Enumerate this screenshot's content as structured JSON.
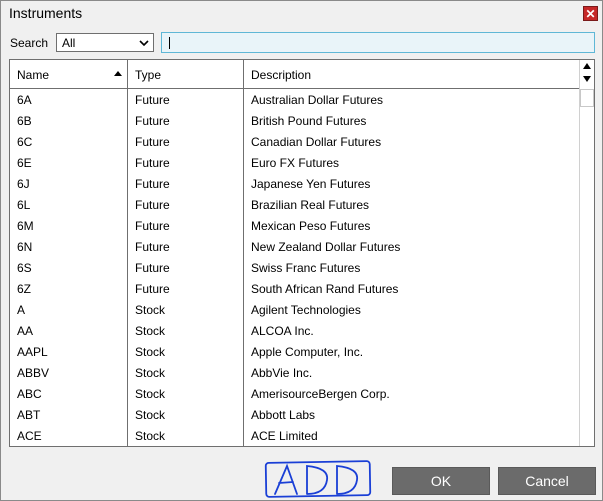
{
  "window": {
    "title": "Instruments"
  },
  "search": {
    "label": "Search",
    "selected": "All",
    "query": ""
  },
  "grid": {
    "columns": [
      "Name",
      "Type",
      "Description"
    ],
    "rows": [
      {
        "name": "6A",
        "type": "Future",
        "description": "Australian Dollar Futures"
      },
      {
        "name": "6B",
        "type": "Future",
        "description": "British Pound Futures"
      },
      {
        "name": "6C",
        "type": "Future",
        "description": "Canadian Dollar Futures"
      },
      {
        "name": "6E",
        "type": "Future",
        "description": "Euro FX Futures"
      },
      {
        "name": "6J",
        "type": "Future",
        "description": "Japanese Yen Futures"
      },
      {
        "name": "6L",
        "type": "Future",
        "description": "Brazilian Real Futures"
      },
      {
        "name": "6M",
        "type": "Future",
        "description": "Mexican Peso Futures"
      },
      {
        "name": "6N",
        "type": "Future",
        "description": "New Zealand Dollar Futures"
      },
      {
        "name": "6S",
        "type": "Future",
        "description": "Swiss Franc Futures"
      },
      {
        "name": "6Z",
        "type": "Future",
        "description": "South African Rand Futures"
      },
      {
        "name": "A",
        "type": "Stock",
        "description": "Agilent Technologies"
      },
      {
        "name": "AA",
        "type": "Stock",
        "description": "ALCOA Inc."
      },
      {
        "name": "AAPL",
        "type": "Stock",
        "description": "Apple Computer, Inc."
      },
      {
        "name": "ABBV",
        "type": "Stock",
        "description": "AbbVie Inc."
      },
      {
        "name": "ABC",
        "type": "Stock",
        "description": "AmerisourceBergen Corp."
      },
      {
        "name": "ABT",
        "type": "Stock",
        "description": "Abbott Labs"
      },
      {
        "name": "ACE",
        "type": "Stock",
        "description": "ACE Limited"
      }
    ]
  },
  "buttons": {
    "ok": "OK",
    "cancel": "Cancel"
  },
  "annotation": {
    "text": "ADD",
    "color": "#1a3fd6"
  },
  "colors": {
    "close": "#c62828",
    "button_bg": "#6b6b6b",
    "search_border": "#5fb7d6"
  },
  "icons": {
    "close": "close-icon",
    "dropdown": "chevron-down-icon",
    "sort": "sort-ascending-icon",
    "scroll_up": "scroll-up-icon",
    "scroll_down": "scroll-down-icon"
  }
}
